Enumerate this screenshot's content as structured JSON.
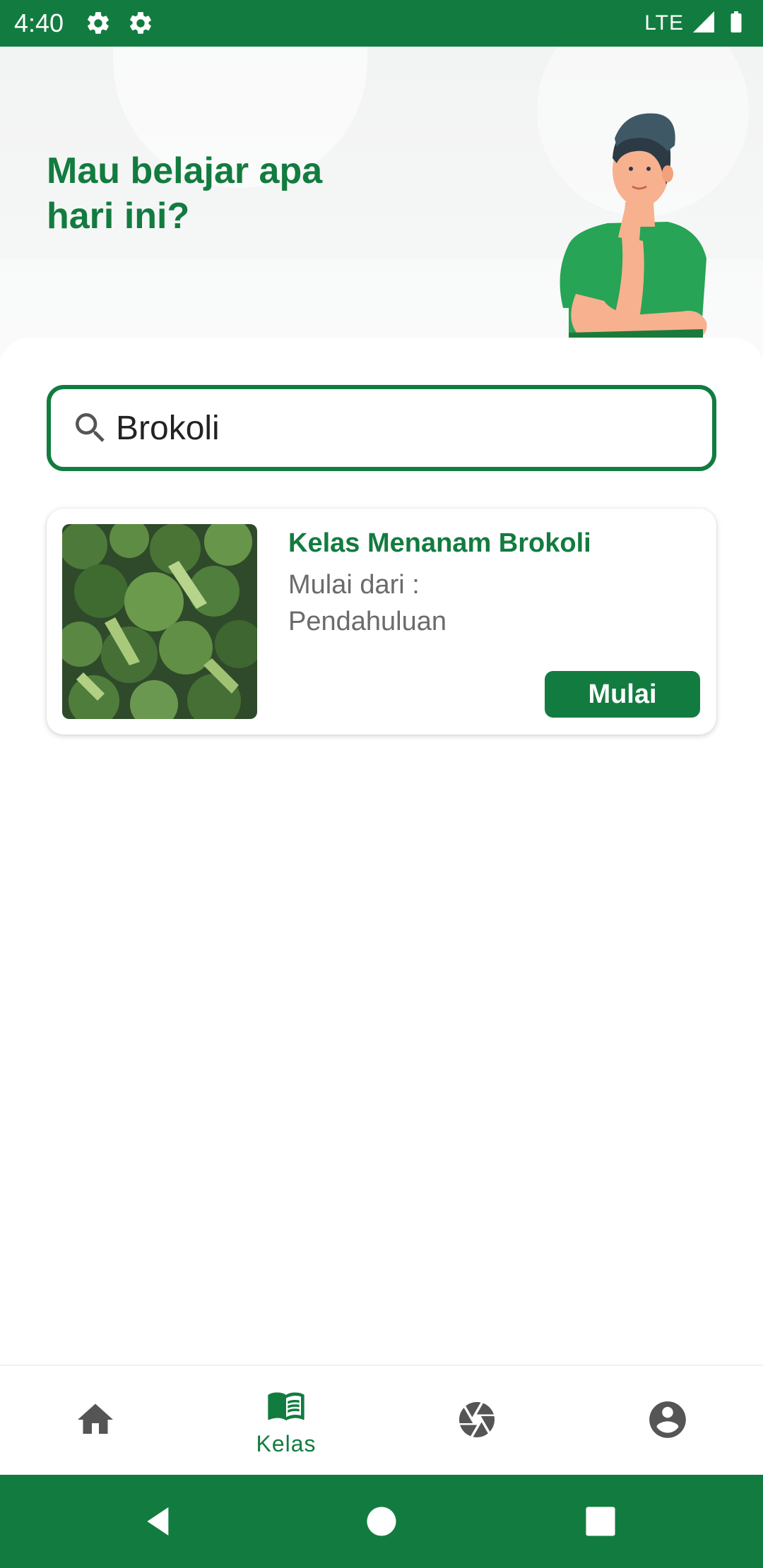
{
  "status_bar": {
    "time": "4:40",
    "network": "LTE",
    "icons": [
      "gear-icon",
      "gear-icon",
      "signal-icon",
      "battery-icon"
    ]
  },
  "hero": {
    "title_line1": "Mau belajar apa",
    "title_line2": "hari ini?",
    "illustration": "thinking-person-illustration"
  },
  "search": {
    "value": "Brokoli",
    "icon": "search-icon"
  },
  "course": {
    "title": "Kelas Menanam Brokoli",
    "sub_line1": "Mulai dari :",
    "sub_line2": "Pendahuluan",
    "button_label": "Mulai",
    "thumbnail": "broccoli-photo"
  },
  "bottom_nav": {
    "items": [
      {
        "icon": "home-icon",
        "label": ""
      },
      {
        "icon": "book-icon",
        "label": "Kelas",
        "active": true
      },
      {
        "icon": "camera-shutter-icon",
        "label": ""
      },
      {
        "icon": "account-icon",
        "label": ""
      }
    ]
  },
  "colors": {
    "primary": "#127c40",
    "title_green": "#137b3f",
    "icon_gray": "#555555",
    "muted_text": "#6b6b6b"
  }
}
